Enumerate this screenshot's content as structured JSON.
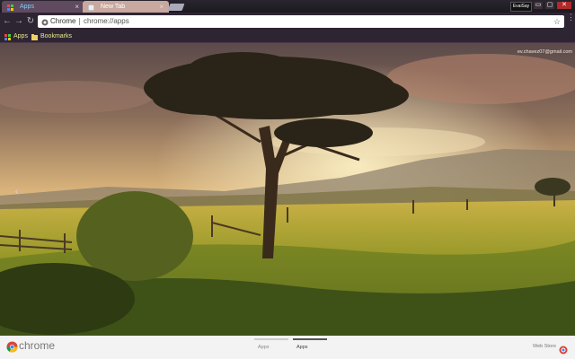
{
  "tabs": [
    {
      "label": "Apps",
      "active": true,
      "close_glyph": "×"
    },
    {
      "label": "New Tab",
      "active": false,
      "close_glyph": "×"
    }
  ],
  "window": {
    "profile_label": "EvaiSay",
    "minimize_glyph": "▭",
    "maximize_glyph": "▢",
    "close_glyph": "✕"
  },
  "toolbar": {
    "back_glyph": "←",
    "forward_glyph": "→",
    "reload_glyph": "↻",
    "omnibox_chip": "Chrome",
    "omnibox_url": "chrome://apps",
    "star_glyph": "☆",
    "menu_glyph": "⋮"
  },
  "bookmarks": [
    {
      "label": "Apps",
      "icon": "apps-grid-icon"
    },
    {
      "label": "Bookmarks",
      "icon": "folder-icon"
    }
  ],
  "page": {
    "user_email": "ev.chavez07@gmail.com",
    "left_arrow": "‹"
  },
  "launcher": {
    "brand": "chrome",
    "page_tabs": [
      {
        "label": "Apps",
        "active": false
      },
      {
        "label": "Apps",
        "active": true
      }
    ],
    "web_store": "Web Store"
  },
  "colors": {
    "tabstrip": "#1c1a20",
    "active_tab": "#5f4a5f",
    "inactive_tab": "#c9a8a0",
    "toolbar": "#2e2533",
    "bookmark_text": "#e8e890",
    "launcher_bg": "#f3f3f3"
  }
}
